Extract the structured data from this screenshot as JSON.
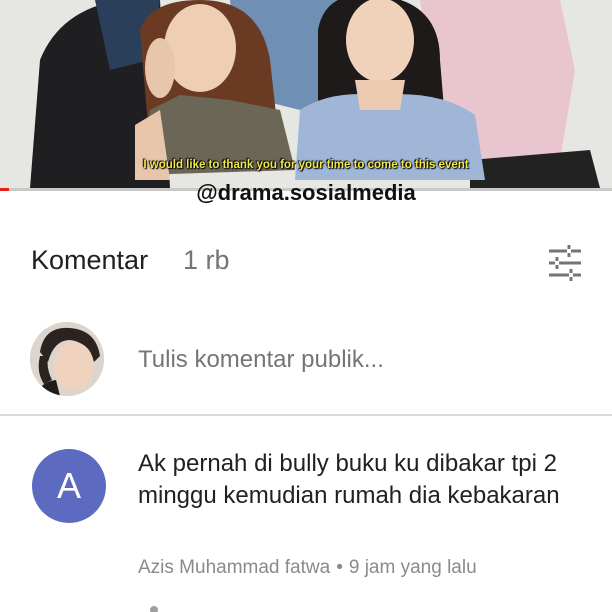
{
  "video": {
    "subtitle": "I would like to thank you for your time to come to this event",
    "progress": 0.015,
    "accent_color": "#e62117"
  },
  "watermark": "@drama.sosialmedia",
  "comments_header": {
    "title": "Komentar",
    "count": "1 rb",
    "filter_icon": "sort-filter-icon"
  },
  "compose": {
    "avatar_icon": "user-avatar",
    "placeholder": "Tulis komentar publik..."
  },
  "comment": {
    "avatar_letter": "A",
    "avatar_color": "#5c6bc0",
    "text": "Ak pernah di bully buku ku dibakar tpi 2 minggu kemudian rumah dia kebakaran",
    "author": "Azis Muhammad fatwa",
    "separator": "•",
    "time": "9 jam yang lalu"
  }
}
